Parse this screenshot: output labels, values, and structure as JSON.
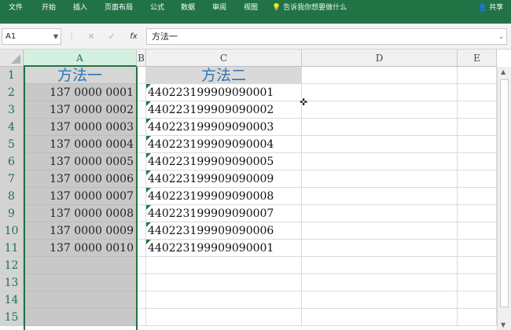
{
  "ribbon": {
    "tabs": [
      "文件",
      "开始",
      "插入",
      "页面布局",
      "公式",
      "数据",
      "审阅",
      "视图"
    ],
    "tell_me": "告诉我你想要做什么",
    "share": "共享",
    "color": "#217346"
  },
  "formula_bar": {
    "name_box": "A1",
    "formula": "方法一"
  },
  "columns": [
    "A",
    "B",
    "C",
    "D",
    "E"
  ],
  "selected_column": "A",
  "rows": [
    "1",
    "2",
    "3",
    "4",
    "5",
    "6",
    "7",
    "8",
    "9",
    "10",
    "11",
    "12",
    "13",
    "14",
    "15"
  ],
  "sheet": {
    "header_A": "方法一",
    "header_C": "方法二",
    "method1": [
      "137  0000  0001",
      "137  0000  0002",
      "137  0000  0003",
      "137  0000  0004",
      "137  0000  0005",
      "137  0000  0006",
      "137  0000  0007",
      "137  0000  0008",
      "137  0000  0009",
      "137  0000  0010"
    ],
    "method2": [
      "440223199909090001",
      "440223199909090002",
      "440223199909090003",
      "440223199909090004",
      "440223199909090005",
      "440223199909090009",
      "440223199909090008",
      "440223199909090007",
      "440223199909090006",
      "440223199909090001"
    ]
  }
}
